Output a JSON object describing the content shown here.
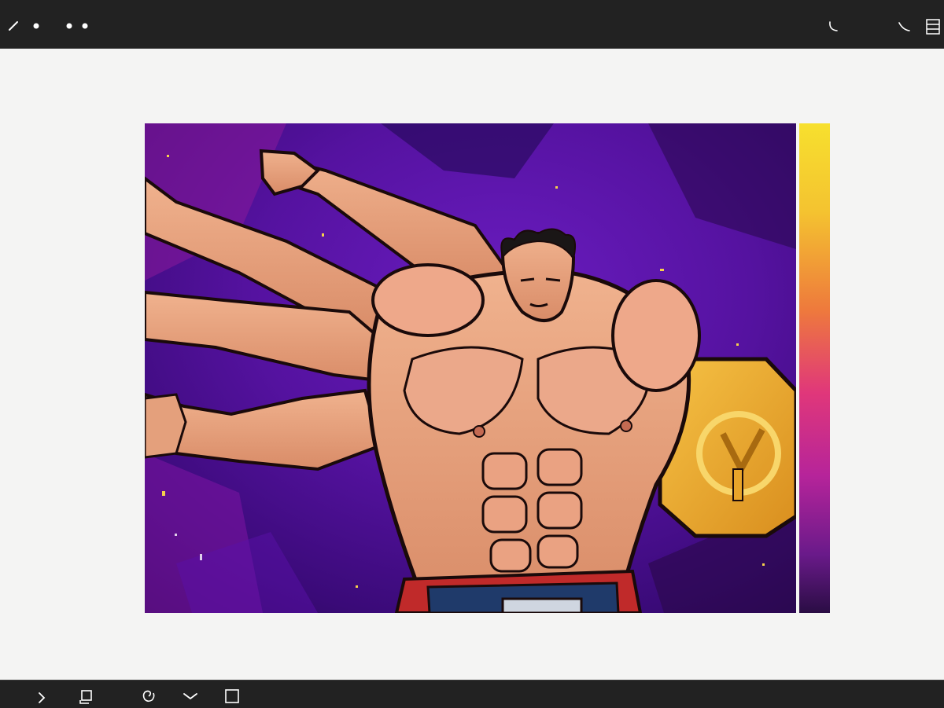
{
  "toolbar": {
    "left_icons": [
      "pencil-icon",
      "dot-icon",
      "more-dots-icon"
    ],
    "right_icons": [
      "undo-arc-icon",
      "redo-arc-icon",
      "layers-panel-icon"
    ]
  },
  "canvas": {
    "background": "#f4f4f3",
    "artwork_palette": [
      "#3a0a7a",
      "#7a1aa8",
      "#e8a37e",
      "#f2b33a",
      "#c4302a"
    ]
  },
  "color_strip": {
    "gradient": [
      "#f7e02e",
      "#ee7a3c",
      "#e0377a",
      "#b6249a",
      "#2a0d44"
    ]
  },
  "bottom_toolbar": {
    "icons": [
      "chevron-right-icon",
      "paste-icon",
      "spiral-icon",
      "chevron-down-icon",
      "square-icon"
    ]
  }
}
